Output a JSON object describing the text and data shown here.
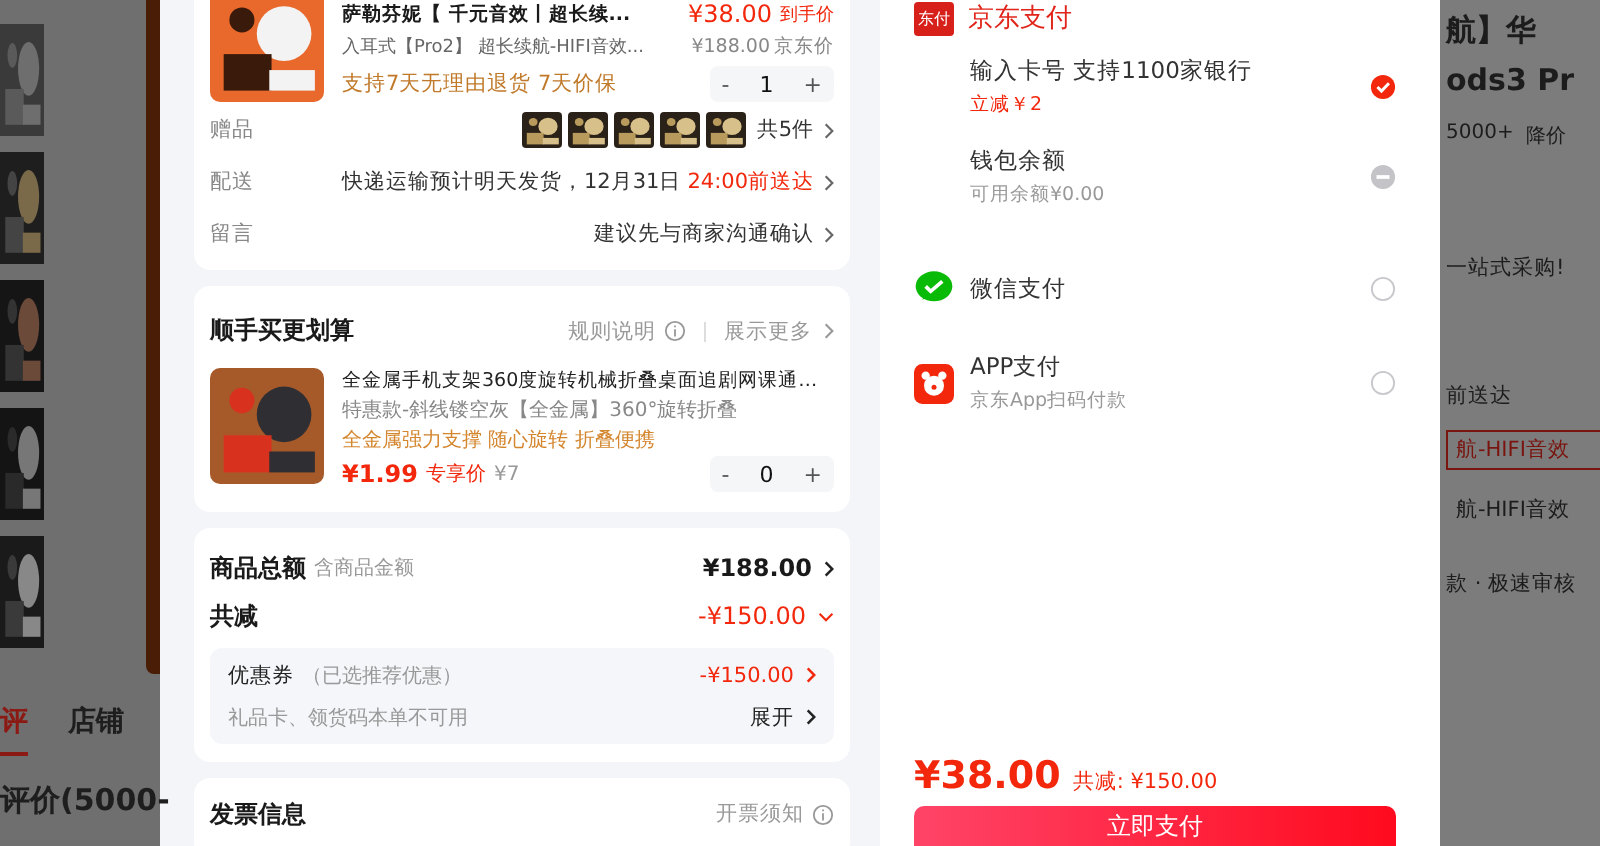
{
  "background_left": {
    "tabs": [
      {
        "label": "评",
        "selected": true
      },
      {
        "label": "店铺",
        "selected": false
      }
    ],
    "heading": "评价(5000-"
  },
  "background_right": {
    "items": [
      {
        "kind": "title",
        "text": "航】华"
      },
      {
        "kind": "title",
        "text": "ods3 Pr"
      },
      {
        "kind": "meta",
        "text": "5000+",
        "extra": "降价"
      },
      {
        "kind": "text",
        "text": "一站式采购!"
      },
      {
        "kind": "text",
        "text": "前送达"
      },
      {
        "kind": "chip",
        "text": "航-HIFI音效",
        "selected": true
      },
      {
        "kind": "chip",
        "text": "航-HIFI音效",
        "selected": false
      },
      {
        "kind": "text",
        "text": "款 · 极速审核"
      }
    ]
  },
  "order": {
    "product": {
      "title": "萨勒芬妮【 千元音效丨超长续...",
      "spec": "入耳式【Pro2】 超长续航-HIFI音效...",
      "tags": "支持7天无理由退货  7天价保",
      "price": "¥38.00",
      "price_label": "到手价",
      "list_price": "¥188.00",
      "list_label": "京东价",
      "stepper": {
        "minus": "-",
        "quantity": "1",
        "plus": "+"
      }
    },
    "rows": [
      {
        "kind": "gifts",
        "label": "赠品",
        "value": "共5件"
      },
      {
        "kind": "delivery",
        "label": "配送",
        "value": "快递运输预计明天发货，12月31日",
        "highlight": "24:00前送达"
      },
      {
        "kind": "note",
        "label": "留言",
        "value": "建议先与商家沟通确认"
      }
    ]
  },
  "addon": {
    "title": "顺手买更划算",
    "rules": "规则说明",
    "more": "展示更多",
    "item": {
      "name": "全金属手机支架360度旋转机械折叠桌面追剧网课通…",
      "spec": "特惠款-斜线镂空灰【全金属】360°旋转折叠",
      "tags": "全金属强力支撑 随心旋转 折叠便携",
      "price": "¥1.99",
      "price_label": "专享价",
      "orig": "¥7",
      "stepper": {
        "minus": "-",
        "quantity": "0",
        "plus": "+"
      }
    }
  },
  "summary": {
    "total_label": "商品总额",
    "total_note": "含商品金额",
    "total": "¥188.00",
    "discount_label": "共减",
    "discount": "-¥150.00",
    "coupon_label": "优惠券",
    "coupon_note": "（已选推荐优惠）",
    "coupon": "-¥150.00",
    "giftcard": "礼品卡、领货码本单不可用",
    "expand": "展开"
  },
  "invoice": {
    "title": "发票信息",
    "notice": "开票须知"
  },
  "payment": {
    "logo": "东付",
    "header": "京东支付",
    "methods": [
      {
        "kind": "card",
        "title": "输入卡号 支持1100家银行",
        "sub": "立减￥2",
        "sub_accent": true,
        "selected": true,
        "disabled": false
      },
      {
        "kind": "wallet",
        "title": "钱包余额",
        "sub": "可用余额¥0.00",
        "sub_accent": false,
        "selected": false,
        "disabled": true
      },
      {
        "kind": "wechat",
        "title": "微信支付",
        "selected": false,
        "disabled": false
      },
      {
        "kind": "app",
        "title": "APP支付",
        "sub": "京东App扫码付款",
        "sub_accent": false,
        "selected": false,
        "disabled": false
      }
    ]
  },
  "total": {
    "amount": "¥38.00",
    "discount": "共减: ¥150.00"
  },
  "pay_button": {
    "label": "立即支付"
  }
}
